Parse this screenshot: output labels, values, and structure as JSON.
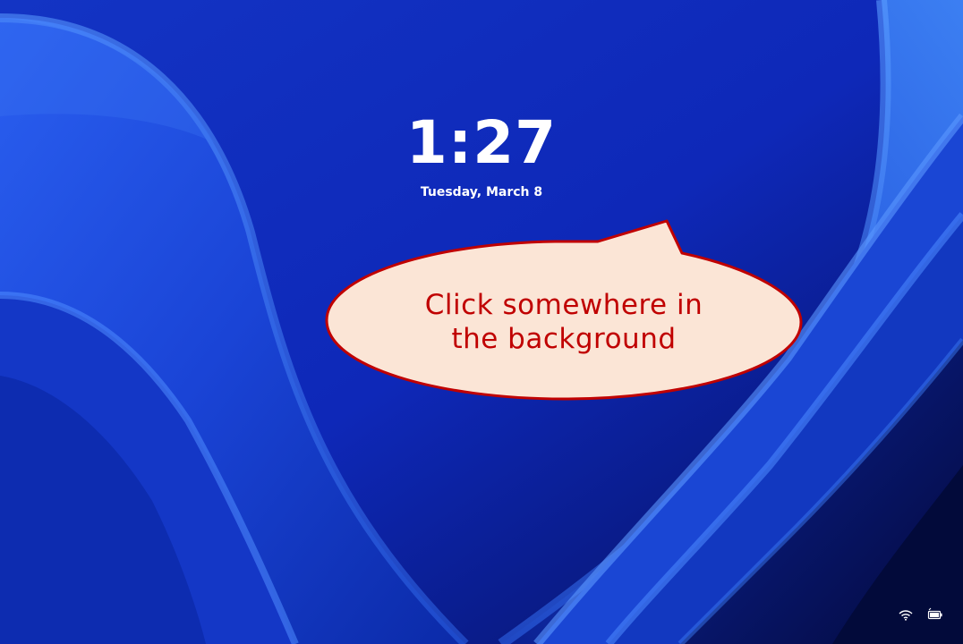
{
  "lock_screen": {
    "time": "1:27",
    "date": "Tuesday, March 8"
  },
  "callout": {
    "line1": "Click somewhere in",
    "line2": "the background",
    "text_color": "#c00000",
    "fill_color": "#fbe5d6",
    "border_color": "#c00000"
  },
  "system_tray": {
    "icons": [
      "wifi-icon",
      "battery-icon"
    ]
  },
  "theme": {
    "wallpaper_base": "#0a1f9e",
    "wallpaper_highlight": "#4a8cf0"
  }
}
